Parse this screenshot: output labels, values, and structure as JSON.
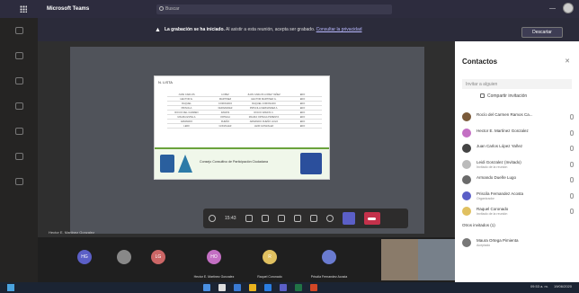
{
  "titlebar": {
    "app_title": "Microsoft Teams",
    "search_placeholder": "Buscar"
  },
  "banner": {
    "title": "La grabación se ha iniciado.",
    "text": "Al asistir a esta reunión, acepta ser grabado.",
    "link": "Consultar la privacidad",
    "dismiss_label": "Descartar"
  },
  "shared_slide": {
    "header": "N. LISTA",
    "table_rows": [
      [
        "JUAN CARLOS",
        "LOPEZ",
        "JUAN CARLOS LOPEZ YAÑEZ",
        "EDO"
      ],
      [
        "HECTOR E.",
        "MARTINEZ",
        "HECTOR MARTINEZ G.",
        "EDO"
      ],
      [
        "RAQUEL",
        "CORONADO",
        "RAQUEL CORONADO",
        "EDO"
      ],
      [
        "PRISCILA",
        "FERNANDEZ",
        "PRISCILA FERNANDEZ A.",
        "EDO"
      ],
      [
        "ROCIO DEL CARMEN",
        "RAMOS",
        "ROCIO RAMOS C.",
        "EDO"
      ],
      [
        "MAURA ESTELA",
        "ORTEGA",
        "MAURA ORTEGA PIMIENTA",
        "EDO"
      ],
      [
        "ARMANDO",
        "DUEÑO",
        "ARMANDO DUEÑO LUGO",
        "EDO"
      ],
      [
        "LEIDI",
        "GONZALEZ",
        "LEIDI GONZALEZ",
        "EDO"
      ]
    ],
    "council": "Consejo Consultivo de Participación Ciudadana"
  },
  "call_controls": {
    "timer": "15:43"
  },
  "caption": "Hector E. Martinez Gonzalez",
  "participants_strip": [
    {
      "initials": "HG",
      "name": "",
      "color": "#5b5fc7"
    },
    {
      "initials": "",
      "name": "",
      "color": "#888888"
    },
    {
      "initials": "LG",
      "name": "",
      "color": "#c66"
    },
    {
      "initials": "HO",
      "name": "Hector E. Martinez Gonzalez",
      "color": "#c36fc3"
    },
    {
      "initials": "R",
      "name": "Raquel Coronado",
      "color": "#e0c060"
    },
    {
      "initials": "",
      "name": "Priscila Fernandez Acosta",
      "color": "#6a7bd0"
    }
  ],
  "panel": {
    "title": "Contactos",
    "invite_placeholder": "Invitar a alguien",
    "share_invite": "Compartir invitación",
    "people": [
      {
        "name": "Rocío del Carmen Ramos Ca...",
        "sub": "",
        "color": "#7a5a3a"
      },
      {
        "name": "Hector E. Martínez Gonzalez",
        "sub": "",
        "color": "#c36fc3"
      },
      {
        "name": "Juan Carlos López Yañez",
        "sub": "",
        "color": "#444444"
      },
      {
        "name": "Leidi Gonzalez (Invitado)",
        "sub": "Invitado de la reunión",
        "color": "#bbbbbb"
      },
      {
        "name": "Armando Dueñe Lugo",
        "sub": "",
        "color": "#6a6a6a"
      },
      {
        "name": "Priscila Fernandez Acosta",
        "sub": "Organizador",
        "color": "#5b5fc7"
      },
      {
        "name": "Raquel Coronado",
        "sub": "Invitado de la reunión",
        "color": "#e0c060"
      }
    ],
    "others_label": "Otros invitados (1)",
    "last_person": {
      "name": "Maura Ortega Pimienta",
      "sub": "Aceptado",
      "color": "#777777"
    }
  },
  "taskbar": {
    "time": "09:53 a. m.",
    "date": "19/06/2020"
  }
}
